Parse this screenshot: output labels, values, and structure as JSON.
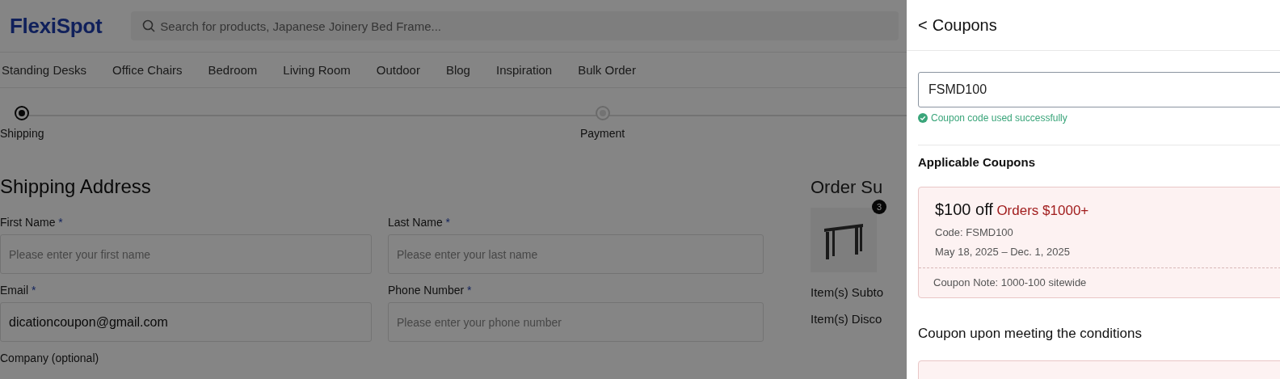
{
  "header": {
    "logo": "FlexiSpot",
    "search": {
      "placeholder": "Search for products, Japanese Joinery Bed Frame..."
    }
  },
  "nav": [
    "Standing Desks",
    "Office Chairs",
    "Bedroom",
    "Living Room",
    "Outdoor",
    "Blog",
    "Inspiration",
    "Bulk Order"
  ],
  "steps": [
    {
      "label": "Shipping",
      "selected": true
    },
    {
      "label": "Payment",
      "selected": false
    }
  ],
  "shipping": {
    "title": "Shipping Address",
    "fields": [
      {
        "label": "First Name",
        "mark": "*",
        "placeholder": "Please enter your first name"
      },
      {
        "label": "Last Name",
        "mark": "*",
        "placeholder": "Please enter your last name"
      },
      {
        "label": "Email",
        "mark": "*",
        "value": "dicationcoupon@gmail.com"
      },
      {
        "label": "Phone Number",
        "mark": "*",
        "placeholder": "Please enter your phone number"
      },
      {
        "label": "Company (optional)"
      }
    ]
  },
  "order_summary": {
    "title": "Order Su",
    "item_count": "3",
    "lines": [
      "Item(s) Subto",
      "Item(s) Disco"
    ]
  },
  "coupons": {
    "back": "<",
    "title": "Coupons",
    "code": {
      "value": "FSMD100"
    },
    "message": "Coupon code used successfully",
    "applicable_title": "Applicable Coupons",
    "applicable": [
      {
        "amount": "$100 off",
        "condition": "Orders $1000+",
        "code": "Code: FSMD100",
        "dates": "May 18, 2025 – Dec. 1, 2025",
        "note": "Coupon Note: 1000-100 sitewide"
      }
    ],
    "conditional_title": "Coupon upon meeting the conditions"
  }
}
